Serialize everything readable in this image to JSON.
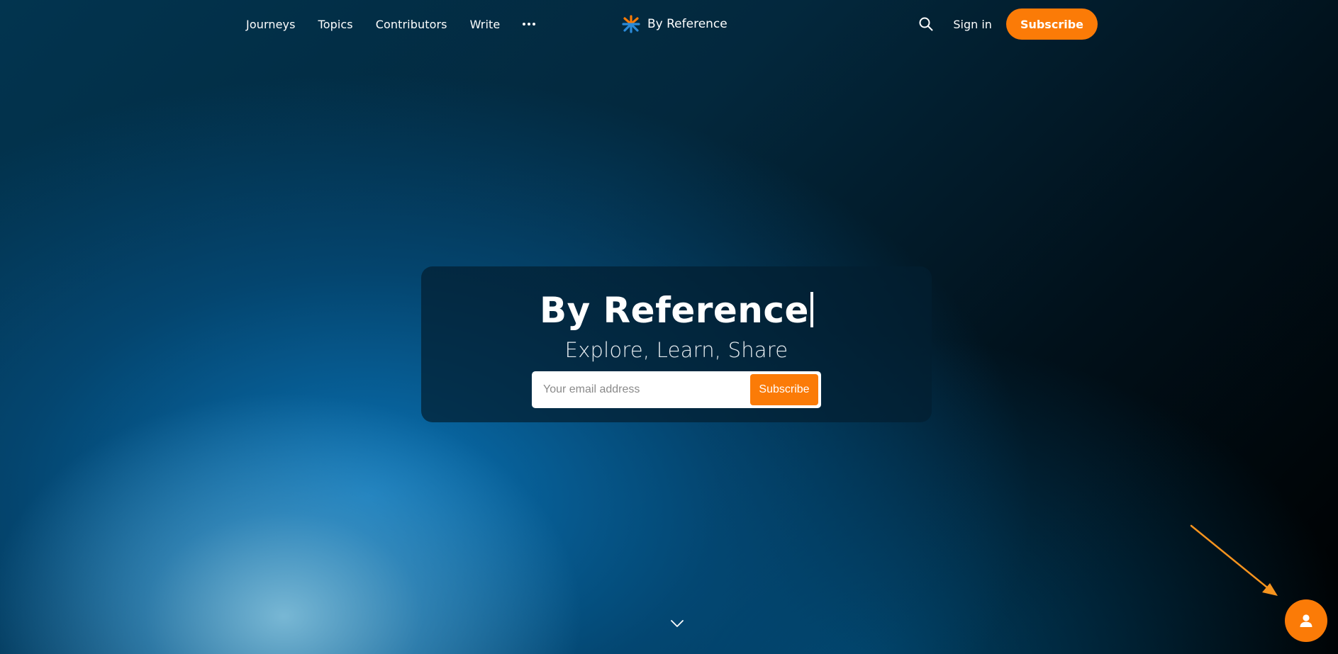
{
  "nav": {
    "links": [
      "Journeys",
      "Topics",
      "Contributors",
      "Write"
    ],
    "more_icon": "more-dots-icon",
    "brand_name": "By Reference",
    "brand_logo_icon": "starburst-logo-icon",
    "search_icon": "search-icon",
    "sign_in": "Sign in",
    "subscribe": "Subscribe"
  },
  "hero": {
    "title": "By Reference",
    "subtitle": "Explore, Learn, Share",
    "email_placeholder": "Your email address",
    "subscribe": "Subscribe"
  },
  "scroll_icon": "chevron-down-icon",
  "portal_icon": "user-icon",
  "colors": {
    "accent": "#fb7b07",
    "background_dark": "#000000",
    "background_blue": "#0a78be"
  }
}
